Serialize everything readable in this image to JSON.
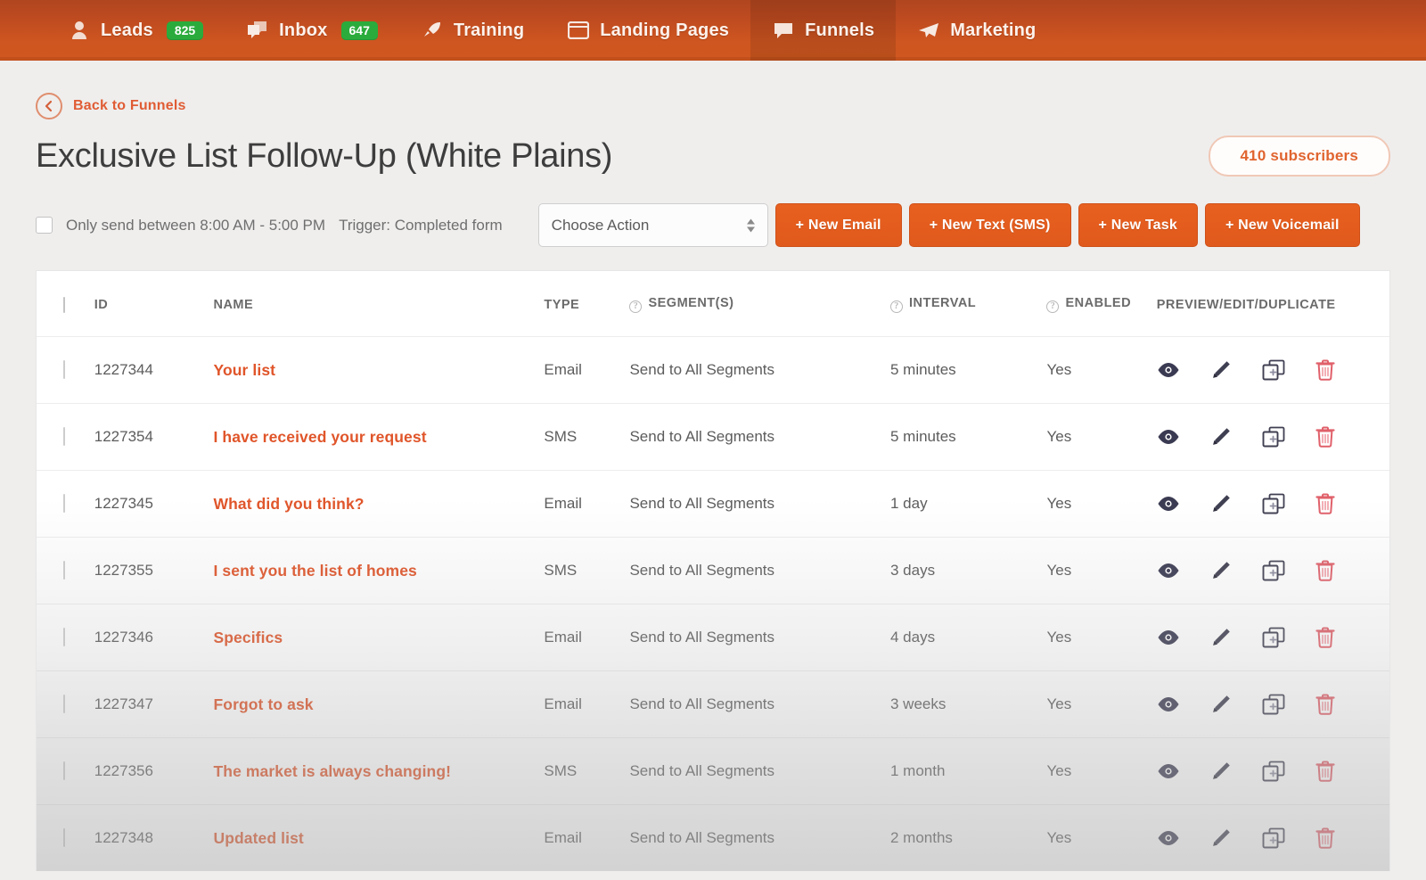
{
  "nav": {
    "items": [
      {
        "label": "Leads",
        "icon": "user-icon",
        "badge": "825",
        "active": false
      },
      {
        "label": "Inbox",
        "icon": "messages-icon",
        "badge": "647",
        "active": false
      },
      {
        "label": "Training",
        "icon": "rocket-icon",
        "badge": null,
        "active": false
      },
      {
        "label": "Landing Pages",
        "icon": "browser-icon",
        "badge": null,
        "active": false
      },
      {
        "label": "Funnels",
        "icon": "speech-bubble-icon",
        "badge": null,
        "active": true
      },
      {
        "label": "Marketing",
        "icon": "paper-plane-icon",
        "badge": null,
        "active": false
      }
    ]
  },
  "header": {
    "back_label": "Back to Funnels",
    "title": "Exclusive List Follow-Up (White Plains)",
    "subscribers": "410 subscribers"
  },
  "toolbar": {
    "only_send_label": "Only send between 8:00 AM - 5:00 PM",
    "trigger_label": "Trigger: Completed form",
    "select_value": "Choose Action",
    "buttons": [
      {
        "label": "+ New Email"
      },
      {
        "label": "+ New Text (SMS)"
      },
      {
        "label": "+ New Task"
      },
      {
        "label": "+ New Voicemail"
      }
    ]
  },
  "table": {
    "columns": {
      "id": "ID",
      "name": "NAME",
      "type": "TYPE",
      "segments": "SEGMENT(S)",
      "interval": "INTERVAL",
      "enabled": "ENABLED",
      "actions": "PREVIEW/EDIT/DUPLICATE"
    },
    "rows": [
      {
        "id": "1227344",
        "name": "Your list",
        "type": "Email",
        "segments": "Send to All Segments",
        "interval": "5 minutes",
        "enabled": "Yes"
      },
      {
        "id": "1227354",
        "name": "I have received your request",
        "type": "SMS",
        "segments": "Send to All Segments",
        "interval": "5 minutes",
        "enabled": "Yes"
      },
      {
        "id": "1227345",
        "name": "What did you think?",
        "type": "Email",
        "segments": "Send to All Segments",
        "interval": "1 day",
        "enabled": "Yes"
      },
      {
        "id": "1227355",
        "name": "I sent you the list of homes",
        "type": "SMS",
        "segments": "Send to All Segments",
        "interval": "3 days",
        "enabled": "Yes"
      },
      {
        "id": "1227346",
        "name": "Specifics",
        "type": "Email",
        "segments": "Send to All Segments",
        "interval": "4 days",
        "enabled": "Yes"
      },
      {
        "id": "1227347",
        "name": "Forgot to ask",
        "type": "Email",
        "segments": "Send to All Segments",
        "interval": "3 weeks",
        "enabled": "Yes"
      },
      {
        "id": "1227356",
        "name": "The market is always changing!",
        "type": "SMS",
        "segments": "Send to All Segments",
        "interval": "1 month",
        "enabled": "Yes"
      },
      {
        "id": "1227348",
        "name": "Updated list",
        "type": "Email",
        "segments": "Send to All Segments",
        "interval": "2 months",
        "enabled": "Yes"
      }
    ],
    "row_action_icons": [
      "eye-icon",
      "pencil-icon",
      "duplicate-icon",
      "trash-icon"
    ]
  },
  "colors": {
    "brand_orange": "#e0552a",
    "nav_gradient_top": "#b0461f",
    "nav_gradient_bottom": "#d1571f",
    "badge_green": "#2bab3c",
    "trash_red": "#e0606a",
    "title_gray": "#3d3d3d"
  }
}
